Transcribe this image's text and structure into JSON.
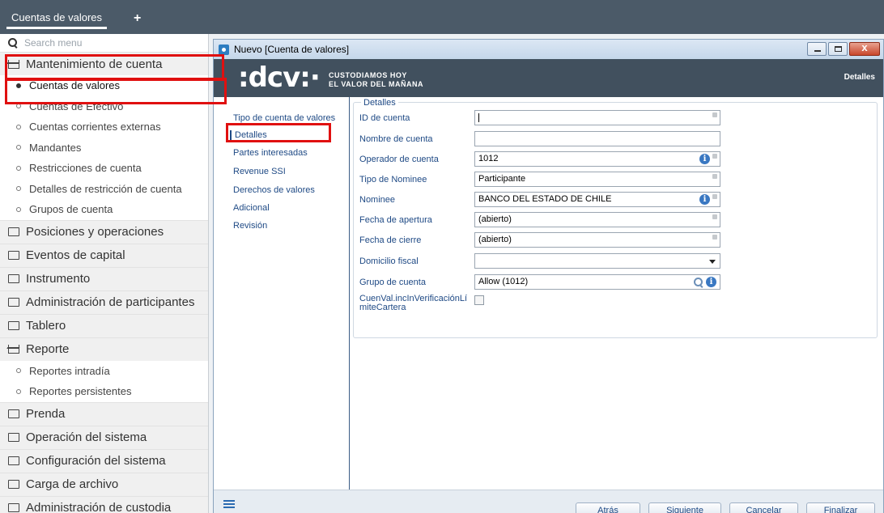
{
  "app_tab": {
    "label": "Cuentas de valores",
    "add_label": "+"
  },
  "sidebar": {
    "search_placeholder": "Search menu",
    "categories": [
      {
        "label": "Mantenimiento de cuenta",
        "items": [
          "Cuentas de valores",
          "Cuentas de Efectivo",
          "Cuentas corrientes externas",
          "Mandantes",
          "Restricciones de cuenta",
          "Detalles de restricción de cuenta",
          "Grupos de cuenta"
        ]
      },
      {
        "label": "Posiciones y operaciones"
      },
      {
        "label": "Eventos de capital"
      },
      {
        "label": "Instrumento"
      },
      {
        "label": "Administración de participantes"
      },
      {
        "label": "Tablero"
      },
      {
        "label": "Reporte",
        "items": [
          "Reportes intradía",
          "Reportes persistentes"
        ]
      },
      {
        "label": "Prenda"
      },
      {
        "label": "Operación del sistema"
      },
      {
        "label": "Configuración del sistema"
      },
      {
        "label": "Carga de archivo"
      },
      {
        "label": "Administración de custodia"
      }
    ]
  },
  "window": {
    "title": "Nuevo [Cuenta de valores]",
    "close_label": "x",
    "banner": {
      "logo": ":dcv:·",
      "slogan_line1": "CUSTODIAMOS HOY",
      "slogan_line2": "EL VALOR DEL MAÑANA",
      "stage": "Detalles"
    },
    "steps": [
      "Tipo de cuenta de valores",
      "Detalles",
      "Partes interesadas",
      "Revenue SSI",
      "Derechos de valores",
      "Adicional",
      "Revisión"
    ],
    "section_title": "Detalles",
    "fields": {
      "id_cuenta": {
        "label": "ID de cuenta",
        "value": ""
      },
      "nombre_cuenta": {
        "label": "Nombre de cuenta",
        "value": ""
      },
      "operador": {
        "label": "Operador de cuenta",
        "value": "1012"
      },
      "tipo_nominee": {
        "label": "Tipo de Nominee",
        "value": "Participante"
      },
      "nominee": {
        "label": "Nominee",
        "value": "BANCO  DEL ESTADO DE CHILE"
      },
      "fecha_apertura": {
        "label": "Fecha de apertura",
        "value": "(abierto)"
      },
      "fecha_cierre": {
        "label": "Fecha de cierre",
        "value": "(abierto)"
      },
      "domicilio": {
        "label": "Domicilio fiscal",
        "value": ""
      },
      "grupo": {
        "label": "Grupo de cuenta",
        "value": "Allow (1012)"
      },
      "verif_line1": "CuenVal.incInVerificaciónLí",
      "verif_line2": "miteCartera"
    },
    "info_glyph": "i",
    "buttons": {
      "back": "Atrás",
      "next": "Siguiente",
      "cancel": "Cancelar",
      "finish": "Finalizar"
    }
  }
}
